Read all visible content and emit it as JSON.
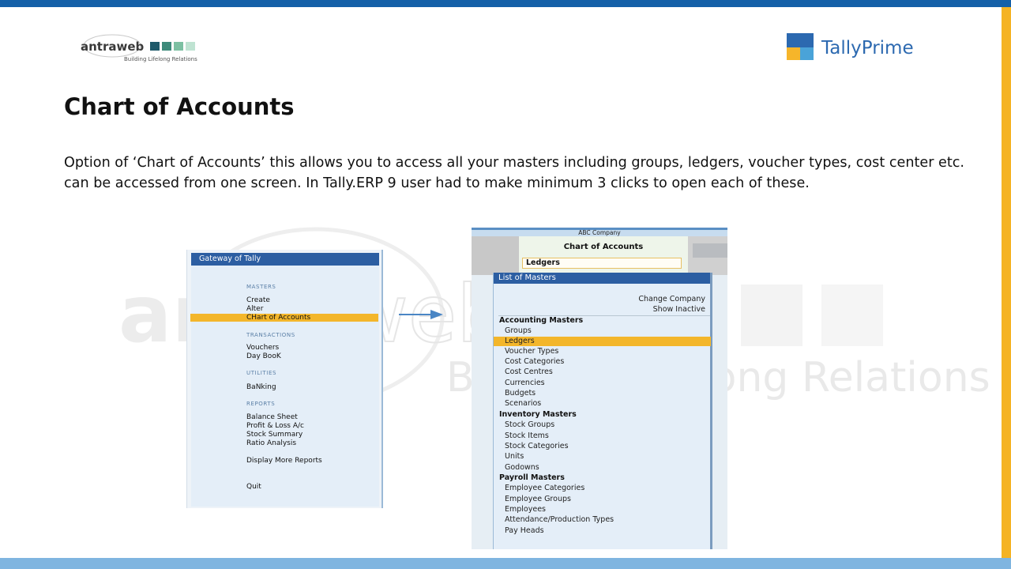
{
  "slide": {
    "title": "Chart of Accounts",
    "description": "Option of ‘Chart of Accounts’ this allows you to access all your masters including groups, ledgers, voucher types, cost center etc. can be accessed from one screen. In Tally.ERP 9 user had to make minimum 3 clicks to open each of these."
  },
  "logos": {
    "antraweb_name": "antraweb",
    "antraweb_tagline": "Building Lifelong Relations",
    "tally_name": "TallyPrime",
    "watermark_tagline": "Building Lifelong Relations"
  },
  "colors": {
    "top_bar": "#1560a8",
    "bottom_bar": "#7fb5e0",
    "right_accent": "#f5b324",
    "tally_header": "#2c5ea2",
    "highlight": "#f3b62b"
  },
  "gateway": {
    "title": "Gateway of Tally",
    "sections": {
      "masters": "MASTERS",
      "transactions": "TRANSACTIONS",
      "utilities": "UTILITIES",
      "reports": "REPORTS"
    },
    "items": {
      "create": "Create",
      "alter": "Alter",
      "chart_of_accounts": "CHart of Accounts",
      "vouchers": "Vouchers",
      "day_book": "Day BooK",
      "banking": "BaNking",
      "balance_sheet": "Balance Sheet",
      "profit_loss": "Profit & Loss A/c",
      "stock_summary": "Stock Summary",
      "ratio_analysis": "Ratio Analysis",
      "display_more_reports": "Display More Reports",
      "quit": "Quit"
    }
  },
  "chart_screen": {
    "company": "ABC Company",
    "title": "Chart of Accounts",
    "selected_value": "Ledgers",
    "list_title": "List of Masters",
    "change_company": "Change Company",
    "show_inactive": "Show Inactive",
    "accounting_masters": "Accounting Masters",
    "accounting_items": [
      "Groups",
      "Ledgers",
      "Voucher Types",
      "Cost Categories",
      "Cost Centres",
      "Currencies",
      "Budgets",
      "Scenarios"
    ],
    "inventory_masters": "Inventory Masters",
    "inventory_items": [
      "Stock Groups",
      "Stock Items",
      "Stock Categories",
      "Units",
      "Godowns"
    ],
    "payroll_masters": "Payroll Masters",
    "payroll_items": [
      "Employee Categories",
      "Employee Groups",
      "Employees",
      "Attendance/Production Types",
      "Pay Heads"
    ]
  }
}
